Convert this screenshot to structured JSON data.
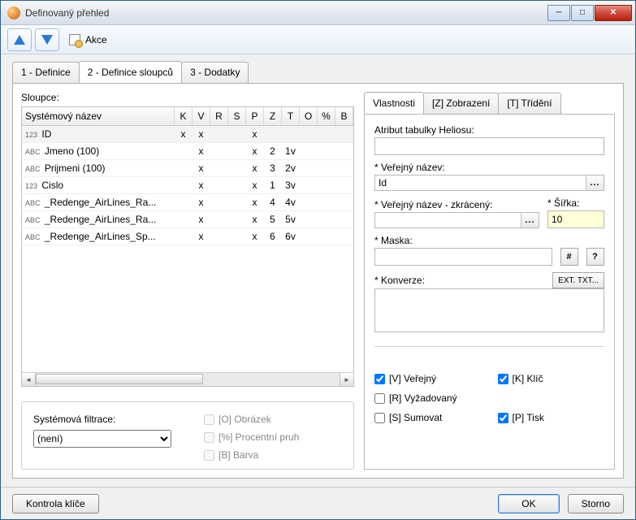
{
  "window": {
    "title": "Definovaný přehled",
    "min_glyph": "─",
    "max_glyph": "□",
    "close_glyph": "✕"
  },
  "toolbar": {
    "akce_label": "Akce"
  },
  "tabs": {
    "t1": "1 - Definice",
    "t2": "2 - Definice sloupců",
    "t3": "3 - Dodatky",
    "active_index": 1
  },
  "left": {
    "section_label": "Sloupce:",
    "columns": {
      "name": "Systémový název",
      "K": "K",
      "V": "V",
      "R": "R",
      "S": "S",
      "P": "P",
      "Z": "Z",
      "T": "T",
      "O": "O",
      "pct": "%",
      "B": "B"
    },
    "rows": [
      {
        "type": "123",
        "name": "ID",
        "K": "x",
        "V": "x",
        "R": "",
        "S": "",
        "P": "x",
        "Z": "",
        "T": "",
        "sel": true
      },
      {
        "type": "ABC",
        "name": "Jmeno (100)",
        "K": "",
        "V": "x",
        "R": "",
        "S": "",
        "P": "x",
        "Z": "2",
        "T": "1v",
        "sel": false
      },
      {
        "type": "ABC",
        "name": "Prijmeni (100)",
        "K": "",
        "V": "x",
        "R": "",
        "S": "",
        "P": "x",
        "Z": "3",
        "T": "2v",
        "sel": false
      },
      {
        "type": "123",
        "name": "Cislo",
        "K": "",
        "V": "x",
        "R": "",
        "S": "",
        "P": "x",
        "Z": "1",
        "T": "3v",
        "sel": false
      },
      {
        "type": "ABC",
        "name": "_Redenge_AirLines_Ra...",
        "K": "",
        "V": "x",
        "R": "",
        "S": "",
        "P": "x",
        "Z": "4",
        "T": "4v",
        "sel": false
      },
      {
        "type": "ABC",
        "name": "_Redenge_AirLines_Ra...",
        "K": "",
        "V": "x",
        "R": "",
        "S": "",
        "P": "x",
        "Z": "5",
        "T": "5v",
        "sel": false
      },
      {
        "type": "ABC",
        "name": "_Redenge_AirLines_Sp...",
        "K": "",
        "V": "x",
        "R": "",
        "S": "",
        "P": "x",
        "Z": "6",
        "T": "6v",
        "sel": false
      }
    ],
    "filter": {
      "label": "Systémová filtrace:",
      "selected": "(není)",
      "chk_o": "[O] Obrázek",
      "chk_pct": "[%] Procentní pruh",
      "chk_b": "[B] Barva"
    }
  },
  "right": {
    "tabs": {
      "p1": "Vlastnosti",
      "p2": "[Z] Zobrazení",
      "p3": "[T] Třídění"
    },
    "attr_label": "Atribut tabulky Heliosu:",
    "attr_value": "",
    "pub_label": "* Veřejný název:",
    "pub_value": "Id",
    "pub_short_label": "* Veřejný název - zkrácený:",
    "pub_short_value": "",
    "width_label": "* Šířka:",
    "width_value": "10",
    "mask_label": "* Maska:",
    "mask_value": "",
    "hash_btn": "#",
    "q_btn": "?",
    "conv_label": "* Konverze:",
    "conv_value": "",
    "ext_btn": "EXT. TXT...",
    "chk_v": "[V] Veřejný",
    "chk_k": "[K] Klíč",
    "chk_r": "[R] Vyžadovaný",
    "chk_s": "[S] Sumovat",
    "chk_p": "[P] Tisk",
    "checked": {
      "v": true,
      "k": true,
      "r": false,
      "s": false,
      "p": true
    }
  },
  "footer": {
    "kontrola": "Kontrola klíče",
    "ok": "OK",
    "storno": "Storno"
  }
}
